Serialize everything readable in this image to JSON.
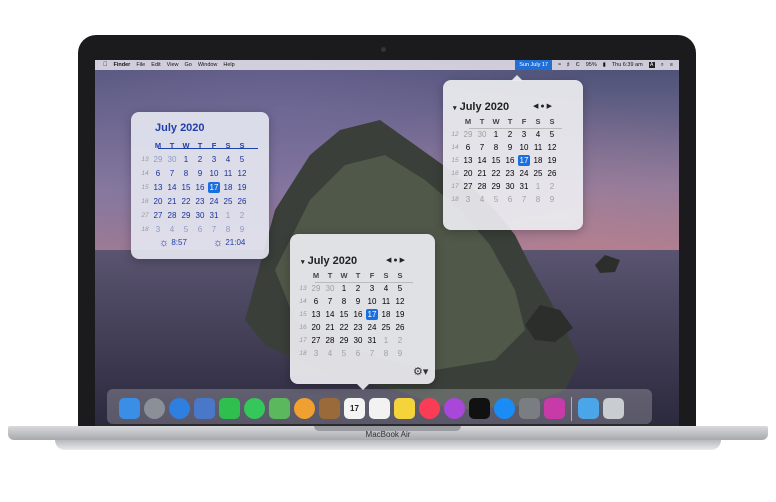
{
  "device": {
    "brand": "MacBook Air"
  },
  "menubar": {
    "items": [
      "Finder",
      "File",
      "Edit",
      "View",
      "Go",
      "Window",
      "Help"
    ],
    "date_badge": "Sun July 17",
    "battery": "95%",
    "clock": "Thu 6:39 am",
    "status_a": "A"
  },
  "calendar_left": {
    "title": "July 2020",
    "weekdays": [
      "M",
      "T",
      "W",
      "T",
      "F",
      "S",
      "S"
    ],
    "weeks": [
      {
        "wk": "13",
        "days": [
          "29",
          "30",
          "1",
          "2",
          "3",
          "4",
          "5"
        ]
      },
      {
        "wk": "14",
        "days": [
          "6",
          "7",
          "8",
          "9",
          "10",
          "11",
          "12"
        ]
      },
      {
        "wk": "15",
        "days": [
          "13",
          "14",
          "15",
          "16",
          "17",
          "18",
          "19"
        ]
      },
      {
        "wk": "16",
        "days": [
          "20",
          "21",
          "22",
          "23",
          "24",
          "25",
          "26"
        ]
      },
      {
        "wk": "27",
        "days": [
          "27",
          "28",
          "29",
          "30",
          "31",
          "1",
          "2"
        ]
      },
      {
        "wk": "18",
        "days": [
          "3",
          "4",
          "5",
          "6",
          "7",
          "8",
          "9"
        ]
      }
    ],
    "sunrise": "8:57",
    "sunset": "21:04"
  },
  "calendar_right": {
    "title": "July 2020",
    "weekdays": [
      "M",
      "T",
      "W",
      "T",
      "F",
      "S",
      "S"
    ],
    "weeks": [
      {
        "wk": "12",
        "days": [
          "29",
          "30",
          "1",
          "2",
          "3",
          "4",
          "5"
        ]
      },
      {
        "wk": "14",
        "days": [
          "6",
          "7",
          "8",
          "9",
          "10",
          "11",
          "12"
        ]
      },
      {
        "wk": "15",
        "days": [
          "13",
          "14",
          "15",
          "16",
          "17",
          "18",
          "19"
        ]
      },
      {
        "wk": "16",
        "days": [
          "20",
          "21",
          "22",
          "23",
          "24",
          "25",
          "26"
        ]
      },
      {
        "wk": "17",
        "days": [
          "27",
          "28",
          "29",
          "30",
          "31",
          "1",
          "2"
        ]
      },
      {
        "wk": "18",
        "days": [
          "3",
          "4",
          "5",
          "6",
          "7",
          "8",
          "9"
        ]
      }
    ]
  },
  "calendar_bottom": {
    "title": "July 2020",
    "weekdays": [
      "M",
      "T",
      "W",
      "T",
      "F",
      "S",
      "S"
    ],
    "weeks": [
      {
        "wk": "13",
        "days": [
          "29",
          "30",
          "1",
          "2",
          "3",
          "4",
          "5"
        ]
      },
      {
        "wk": "14",
        "days": [
          "6",
          "7",
          "8",
          "9",
          "10",
          "11",
          "12"
        ]
      },
      {
        "wk": "15",
        "days": [
          "13",
          "14",
          "15",
          "16",
          "17",
          "18",
          "19"
        ]
      },
      {
        "wk": "16",
        "days": [
          "20",
          "21",
          "22",
          "23",
          "24",
          "25",
          "26"
        ]
      },
      {
        "wk": "17",
        "days": [
          "27",
          "28",
          "29",
          "30",
          "31",
          "1",
          "2"
        ]
      },
      {
        "wk": "18",
        "days": [
          "3",
          "4",
          "5",
          "6",
          "7",
          "8",
          "9"
        ]
      }
    ]
  },
  "dock": {
    "apps": [
      {
        "name": "finder-icon",
        "color": "#3a8ee6"
      },
      {
        "name": "launchpad-icon",
        "color": "#8a8f98"
      },
      {
        "name": "safari-icon",
        "color": "#2f7fe0"
      },
      {
        "name": "preview-icon",
        "color": "#4a78c8"
      },
      {
        "name": "facetime-icon",
        "color": "#2fbf4f"
      },
      {
        "name": "messages-icon",
        "color": "#35c75a"
      },
      {
        "name": "maps-icon",
        "color": "#5cb85c"
      },
      {
        "name": "photos-icon",
        "color": "#f0a030"
      },
      {
        "name": "notebook-icon",
        "color": "#9b6a3a"
      },
      {
        "name": "calendar-icon",
        "color": "#f4f4f4"
      },
      {
        "name": "reminders-icon",
        "color": "#f2f2f2"
      },
      {
        "name": "notes-icon",
        "color": "#f5d33a"
      },
      {
        "name": "music-icon",
        "color": "#fa3d55"
      },
      {
        "name": "podcasts-icon",
        "color": "#a847d9"
      },
      {
        "name": "tv-icon",
        "color": "#111111"
      },
      {
        "name": "app-store-icon",
        "color": "#1a8cf5"
      },
      {
        "name": "system-preferences-icon",
        "color": "#7a7d82"
      },
      {
        "name": "feedback-icon",
        "color": "#c83aa8"
      },
      {
        "name": "downloads-folder-icon",
        "color": "#4aa6e8"
      },
      {
        "name": "trash-icon",
        "color": "#c9ccd1"
      }
    ]
  },
  "colors": {
    "accent": "#1a6fe0",
    "left_widget_text": "#1f3fa8"
  },
  "today": "17"
}
